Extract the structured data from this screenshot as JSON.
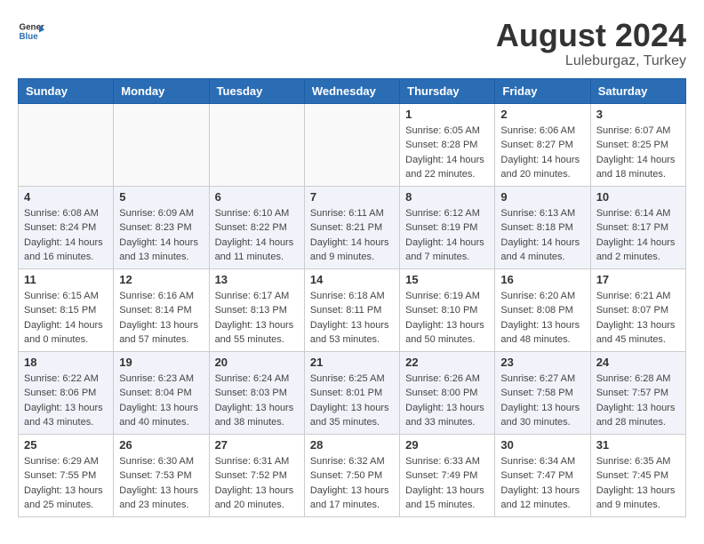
{
  "header": {
    "logo_general": "General",
    "logo_blue": "Blue",
    "month_year": "August 2024",
    "location": "Luleburgaz, Turkey"
  },
  "days_of_week": [
    "Sunday",
    "Monday",
    "Tuesday",
    "Wednesday",
    "Thursday",
    "Friday",
    "Saturday"
  ],
  "weeks": [
    [
      {
        "day": "",
        "info": ""
      },
      {
        "day": "",
        "info": ""
      },
      {
        "day": "",
        "info": ""
      },
      {
        "day": "",
        "info": ""
      },
      {
        "day": "1",
        "info": "Sunrise: 6:05 AM\nSunset: 8:28 PM\nDaylight: 14 hours\nand 22 minutes."
      },
      {
        "day": "2",
        "info": "Sunrise: 6:06 AM\nSunset: 8:27 PM\nDaylight: 14 hours\nand 20 minutes."
      },
      {
        "day": "3",
        "info": "Sunrise: 6:07 AM\nSunset: 8:25 PM\nDaylight: 14 hours\nand 18 minutes."
      }
    ],
    [
      {
        "day": "4",
        "info": "Sunrise: 6:08 AM\nSunset: 8:24 PM\nDaylight: 14 hours\nand 16 minutes."
      },
      {
        "day": "5",
        "info": "Sunrise: 6:09 AM\nSunset: 8:23 PM\nDaylight: 14 hours\nand 13 minutes."
      },
      {
        "day": "6",
        "info": "Sunrise: 6:10 AM\nSunset: 8:22 PM\nDaylight: 14 hours\nand 11 minutes."
      },
      {
        "day": "7",
        "info": "Sunrise: 6:11 AM\nSunset: 8:21 PM\nDaylight: 14 hours\nand 9 minutes."
      },
      {
        "day": "8",
        "info": "Sunrise: 6:12 AM\nSunset: 8:19 PM\nDaylight: 14 hours\nand 7 minutes."
      },
      {
        "day": "9",
        "info": "Sunrise: 6:13 AM\nSunset: 8:18 PM\nDaylight: 14 hours\nand 4 minutes."
      },
      {
        "day": "10",
        "info": "Sunrise: 6:14 AM\nSunset: 8:17 PM\nDaylight: 14 hours\nand 2 minutes."
      }
    ],
    [
      {
        "day": "11",
        "info": "Sunrise: 6:15 AM\nSunset: 8:15 PM\nDaylight: 14 hours\nand 0 minutes."
      },
      {
        "day": "12",
        "info": "Sunrise: 6:16 AM\nSunset: 8:14 PM\nDaylight: 13 hours\nand 57 minutes."
      },
      {
        "day": "13",
        "info": "Sunrise: 6:17 AM\nSunset: 8:13 PM\nDaylight: 13 hours\nand 55 minutes."
      },
      {
        "day": "14",
        "info": "Sunrise: 6:18 AM\nSunset: 8:11 PM\nDaylight: 13 hours\nand 53 minutes."
      },
      {
        "day": "15",
        "info": "Sunrise: 6:19 AM\nSunset: 8:10 PM\nDaylight: 13 hours\nand 50 minutes."
      },
      {
        "day": "16",
        "info": "Sunrise: 6:20 AM\nSunset: 8:08 PM\nDaylight: 13 hours\nand 48 minutes."
      },
      {
        "day": "17",
        "info": "Sunrise: 6:21 AM\nSunset: 8:07 PM\nDaylight: 13 hours\nand 45 minutes."
      }
    ],
    [
      {
        "day": "18",
        "info": "Sunrise: 6:22 AM\nSunset: 8:06 PM\nDaylight: 13 hours\nand 43 minutes."
      },
      {
        "day": "19",
        "info": "Sunrise: 6:23 AM\nSunset: 8:04 PM\nDaylight: 13 hours\nand 40 minutes."
      },
      {
        "day": "20",
        "info": "Sunrise: 6:24 AM\nSunset: 8:03 PM\nDaylight: 13 hours\nand 38 minutes."
      },
      {
        "day": "21",
        "info": "Sunrise: 6:25 AM\nSunset: 8:01 PM\nDaylight: 13 hours\nand 35 minutes."
      },
      {
        "day": "22",
        "info": "Sunrise: 6:26 AM\nSunset: 8:00 PM\nDaylight: 13 hours\nand 33 minutes."
      },
      {
        "day": "23",
        "info": "Sunrise: 6:27 AM\nSunset: 7:58 PM\nDaylight: 13 hours\nand 30 minutes."
      },
      {
        "day": "24",
        "info": "Sunrise: 6:28 AM\nSunset: 7:57 PM\nDaylight: 13 hours\nand 28 minutes."
      }
    ],
    [
      {
        "day": "25",
        "info": "Sunrise: 6:29 AM\nSunset: 7:55 PM\nDaylight: 13 hours\nand 25 minutes."
      },
      {
        "day": "26",
        "info": "Sunrise: 6:30 AM\nSunset: 7:53 PM\nDaylight: 13 hours\nand 23 minutes."
      },
      {
        "day": "27",
        "info": "Sunrise: 6:31 AM\nSunset: 7:52 PM\nDaylight: 13 hours\nand 20 minutes."
      },
      {
        "day": "28",
        "info": "Sunrise: 6:32 AM\nSunset: 7:50 PM\nDaylight: 13 hours\nand 17 minutes."
      },
      {
        "day": "29",
        "info": "Sunrise: 6:33 AM\nSunset: 7:49 PM\nDaylight: 13 hours\nand 15 minutes."
      },
      {
        "day": "30",
        "info": "Sunrise: 6:34 AM\nSunset: 7:47 PM\nDaylight: 13 hours\nand 12 minutes."
      },
      {
        "day": "31",
        "info": "Sunrise: 6:35 AM\nSunset: 7:45 PM\nDaylight: 13 hours\nand 9 minutes."
      }
    ]
  ]
}
